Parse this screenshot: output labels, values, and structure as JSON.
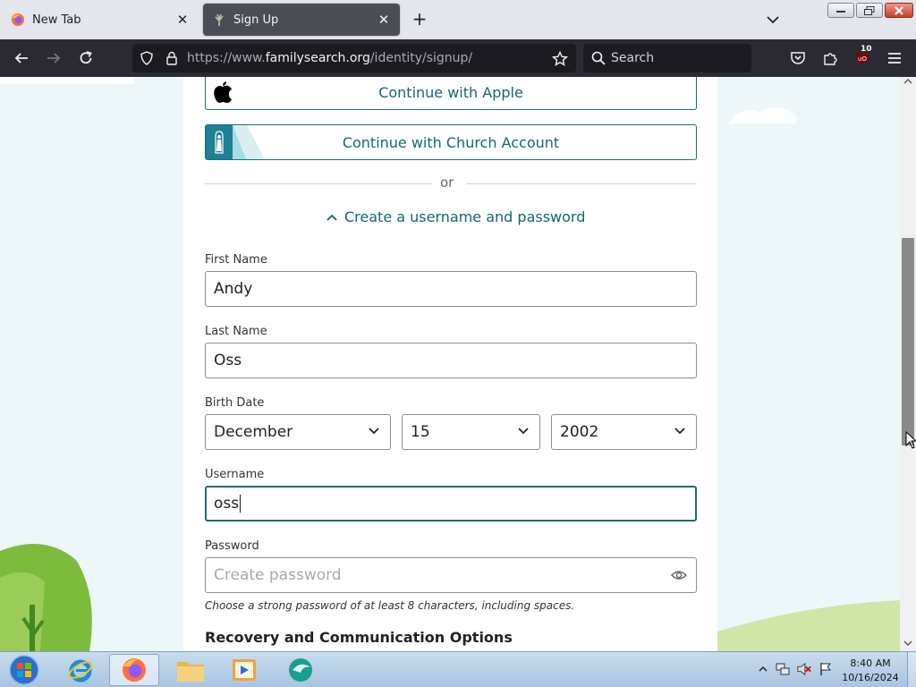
{
  "browser": {
    "tabs": [
      {
        "title": "New Tab",
        "active": false,
        "icon": "firefox-icon"
      },
      {
        "title": "Sign Up",
        "active": true,
        "icon": "familysearch-tree-icon"
      }
    ],
    "url": {
      "prefix": "https://www.",
      "domain": "familysearch.org",
      "path": "/identity/signup/"
    },
    "search_placeholder": "Search",
    "extension_badge": "10"
  },
  "signup": {
    "apple_button": "Continue with Apple",
    "church_button": "Continue with Church Account",
    "or_text": "or",
    "toggle_link": "Create a username and password",
    "first_name": {
      "label": "First Name",
      "value": "Andy"
    },
    "last_name": {
      "label": "Last Name",
      "value": "Oss"
    },
    "birth_date": {
      "label": "Birth Date",
      "month": "December",
      "day": "15",
      "year": "2002"
    },
    "username": {
      "label": "Username",
      "value": "oss"
    },
    "password": {
      "label": "Password",
      "placeholder": "Create password"
    },
    "password_hint": "Choose a strong password of at least 8 characters, including spaces.",
    "recovery_title": "Recovery and Communication Options"
  },
  "taskbar": {
    "time": "8:40 AM",
    "date": "10/16/2024"
  },
  "colors": {
    "accent": "#16686e",
    "page_bg": "#edf7f9",
    "toolbar_bg": "#2b2a33",
    "tree_green": "#7dbb3c"
  }
}
